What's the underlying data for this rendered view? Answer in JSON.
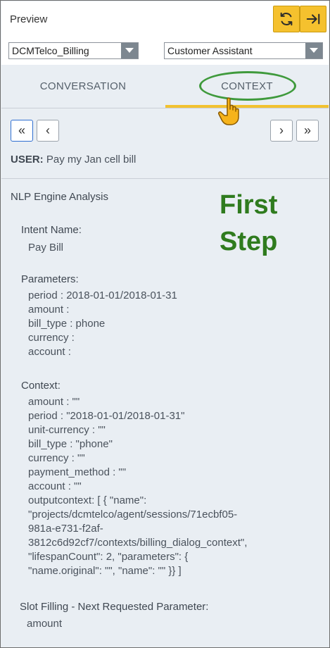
{
  "header": {
    "title": "Preview",
    "refresh_icon": "refresh-icon",
    "forward_icon": "arrow-right-to-bar-icon",
    "accent": "#f5c12e"
  },
  "selects": {
    "bot": "DCMTelco_Billing",
    "assistant": "Customer Assistant"
  },
  "tabs": {
    "conversation": "CONVERSATION",
    "context": "CONTEXT",
    "active": "context"
  },
  "pager": {
    "first": "«",
    "prev": "‹",
    "next": "›",
    "last": "»"
  },
  "user": {
    "label": "USER:",
    "text": "Pay my Jan cell bill"
  },
  "annotation": {
    "line1": "First",
    "line2": "Step",
    "color": "#2f7b1e"
  },
  "analysis": {
    "title": "NLP Engine Analysis",
    "intent_label": "Intent Name:",
    "intent_value": "Pay Bill",
    "parameters_label": "Parameters:",
    "parameters": [
      "period : 2018-01-01/2018-01-31",
      "amount :",
      "bill_type : phone",
      "currency :",
      "account :"
    ],
    "context_label": "Context:",
    "context": [
      "amount : \"\"",
      "period : \"2018-01-01/2018-01-31\"",
      "unit-currency : \"\"",
      "bill_type : \"phone\"",
      "currency : \"\"",
      "payment_method : \"\"",
      "account : \"\"",
      "outputcontext: [ { \"name\":",
      "\"projects/dcmtelco/agent/sessions/71ecbf05-",
      "981a-e731-f2af-",
      "3812c6d92cf7/contexts/billing_dialog_context\",",
      "\"lifespanCount\": 2, \"parameters\": {",
      "\"name.original\": \"\", \"name\": \"\" }} ]"
    ],
    "slot_label": "Slot Filling - Next Requested Parameter:",
    "slot_value": "amount"
  }
}
